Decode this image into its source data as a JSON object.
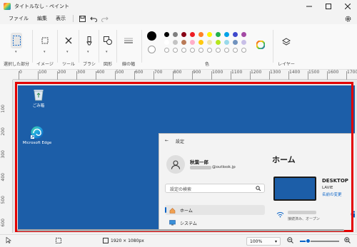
{
  "window": {
    "title": "タイトルなし - ペイント",
    "controls": [
      "minimize",
      "maximize",
      "close"
    ]
  },
  "menu": {
    "items": [
      "ファイル",
      "編集",
      "表示"
    ],
    "quick_actions": [
      "save-icon",
      "undo-icon",
      "redo-icon"
    ],
    "settings_icon": "gear-icon"
  },
  "ribbon": {
    "groups": {
      "selection": "選択した部分",
      "image": "イメージ",
      "tools": "ツール",
      "brushes": "ブラシ",
      "shapes": "図形",
      "size": "線の幅",
      "colors": "色",
      "layers": "レイヤー"
    },
    "palette_row1": [
      "#000000",
      "#7f7f7f",
      "#880015",
      "#ed1c24",
      "#ff7f27",
      "#fff200",
      "#22b14c",
      "#00a2e8",
      "#3f48cc",
      "#a349a4"
    ],
    "palette_row2": [
      "#ffffff",
      "#c3c3c3",
      "#b97a57",
      "#ffaec9",
      "#ffc90e",
      "#efe4b0",
      "#b5e61d",
      "#99d9ea",
      "#7092be",
      "#c8bfe7"
    ],
    "primary_color": "#000000",
    "secondary_color": "#ffffff"
  },
  "rulers": {
    "top": [
      "0",
      "100",
      "200",
      "300",
      "400",
      "500",
      "600",
      "700",
      "800",
      "900",
      "1000",
      "1100",
      "1200",
      "1300",
      "1400",
      "1500",
      "1600",
      "1700"
    ],
    "left": [
      "100",
      "200",
      "300",
      "400",
      "500",
      "600"
    ]
  },
  "canvas": {
    "desktop_bg": "#1c5ea8",
    "selection_color": "#e30000",
    "icons": [
      {
        "label": "ごみ箱",
        "icon": "recycle-bin-icon"
      },
      {
        "label": "Microsoft Edge",
        "icon": "edge-icon"
      }
    ],
    "settings_window": {
      "app_title": "設定",
      "back": "←",
      "user_name": "秋葉一郎",
      "email_suffix": "@outlook.jp",
      "search_placeholder": "設定の検索",
      "nav": [
        {
          "label": "ホーム",
          "active": true
        },
        {
          "label": "システム",
          "active": false
        }
      ],
      "page_title": "ホーム",
      "device_name": "DESKTOP",
      "device_model": "LAVIE",
      "rename_link": "名前の変更",
      "wifi_status": "接続済み、オープン"
    }
  },
  "status": {
    "selection_icon": "selection-icon",
    "image_size": "1920 × 1080px",
    "zoom": "100%",
    "zoom_fraction": 0.2
  }
}
